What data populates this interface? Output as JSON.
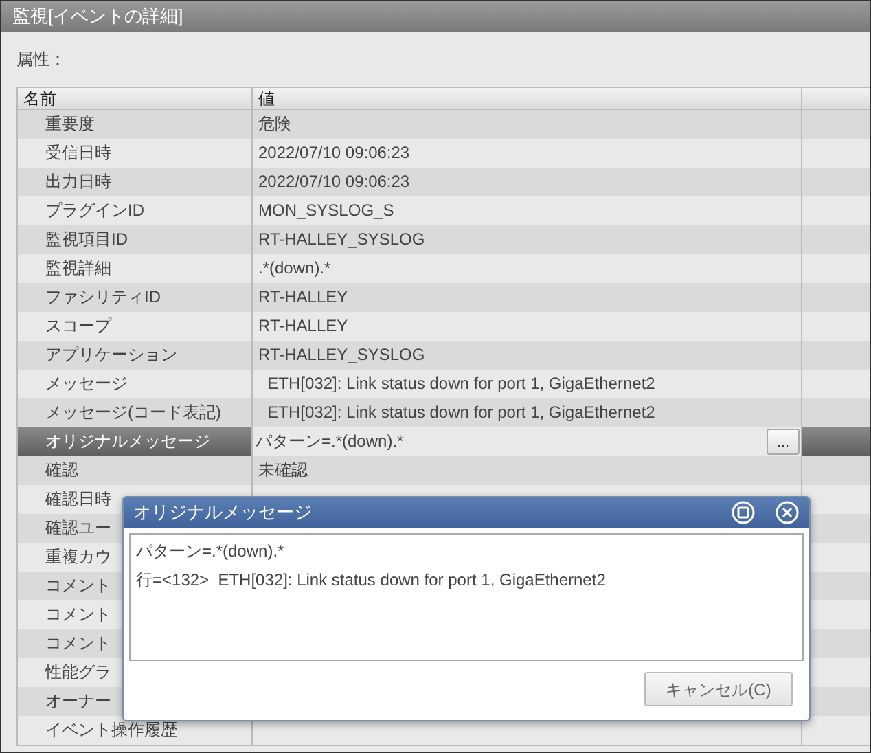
{
  "window": {
    "title": "監視[イベントの詳細]"
  },
  "section_label": "属性：",
  "table": {
    "columns": [
      "名前",
      "値"
    ],
    "rows": [
      {
        "name": "重要度",
        "value": "危険",
        "selected": false
      },
      {
        "name": "受信日時",
        "value": "2022/07/10 09:06:23",
        "selected": false
      },
      {
        "name": "出力日時",
        "value": "2022/07/10 09:06:23",
        "selected": false
      },
      {
        "name": "プラグインID",
        "value": "MON_SYSLOG_S",
        "selected": false
      },
      {
        "name": "監視項目ID",
        "value": "RT-HALLEY_SYSLOG",
        "selected": false
      },
      {
        "name": "監視詳細",
        "value": ".*(down).*",
        "selected": false
      },
      {
        "name": "ファシリティID",
        "value": "RT-HALLEY",
        "selected": false
      },
      {
        "name": "スコープ",
        "value": "RT-HALLEY",
        "selected": false
      },
      {
        "name": "アプリケーション",
        "value": "RT-HALLEY_SYSLOG",
        "selected": false
      },
      {
        "name": "メッセージ",
        "value": "  ETH[032]: Link status down for port 1, GigaEthernet2",
        "selected": false
      },
      {
        "name": "メッセージ(コード表記)",
        "value": "  ETH[032]: Link status down for port 1, GigaEthernet2",
        "selected": false
      },
      {
        "name": "オリジナルメッセージ",
        "value": "パターン=.*(down).*",
        "selected": true,
        "button": "..."
      },
      {
        "name": "確認",
        "value": "未確認",
        "selected": false
      },
      {
        "name": "確認日時",
        "selected": false
      },
      {
        "name": "確認ユー",
        "selected": false
      },
      {
        "name": "重複カウ",
        "selected": false
      },
      {
        "name": "コメント",
        "selected": false
      },
      {
        "name": "コメント",
        "selected": false
      },
      {
        "name": "コメント",
        "selected": false
      },
      {
        "name": "性能グラ",
        "selected": false
      },
      {
        "name": "オーナー",
        "selected": false
      },
      {
        "name": "イベント操作履歴",
        "selected": false
      }
    ]
  },
  "dialog": {
    "title": "オリジナルメッセージ",
    "lines": [
      "パターン=.*(down).*",
      "行=<132>  ETH[032]: Link status down for port 1, GigaEthernet2"
    ],
    "cancel_button": "キャンセル(C)"
  }
}
